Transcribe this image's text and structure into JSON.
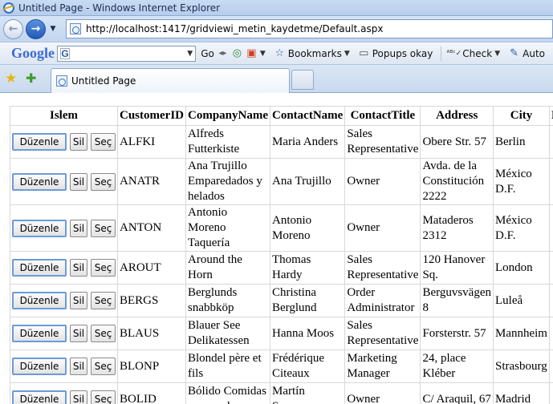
{
  "window": {
    "title": "Untitled Page - Windows Internet Explorer"
  },
  "address_bar": {
    "url": "http://localhost:1417/gridviewi_metin_kaydetme/Default.aspx"
  },
  "toolbar": {
    "google_label": "Google",
    "google_search_prefix": "G",
    "go_label": "Go",
    "bookmarks_label": "Bookmarks",
    "popups_label": "Popups okay",
    "check_label": "Check",
    "auto_label": "Auto"
  },
  "tab": {
    "title": "Untitled Page"
  },
  "grid": {
    "headers": [
      "Islem",
      "CustomerID",
      "CompanyName",
      "ContactName",
      "ContactTitle",
      "Address",
      "City",
      "R"
    ],
    "buttons": {
      "edit": "Düzenle",
      "delete": "Sil",
      "select": "Seç"
    },
    "rows": [
      {
        "id": "ALFKI",
        "company": "Alfreds Futterkiste",
        "contact": "Maria Anders",
        "title": "Sales Representative",
        "address": "Obere Str. 57",
        "city": "Berlin"
      },
      {
        "id": "ANATR",
        "company": "Ana Trujillo Emparedados y helados",
        "contact": "Ana Trujillo",
        "title": "Owner",
        "address": "Avda. de la Constitución 2222",
        "city": "México D.F."
      },
      {
        "id": "ANTON",
        "company": "Antonio Moreno Taquería",
        "contact": "Antonio Moreno",
        "title": "Owner",
        "address": "Mataderos 2312",
        "city": "México D.F."
      },
      {
        "id": "AROUT",
        "company": "Around the Horn",
        "contact": "Thomas Hardy",
        "title": "Sales Representative",
        "address": "120 Hanover Sq.",
        "city": "London"
      },
      {
        "id": "BERGS",
        "company": "Berglunds snabbköp",
        "contact": "Christina Berglund",
        "title": "Order Administrator",
        "address": "Berguvsvägen 8",
        "city": "Luleå"
      },
      {
        "id": "BLAUS",
        "company": "Blauer See Delikatessen",
        "contact": "Hanna Moos",
        "title": "Sales Representative",
        "address": "Forsterstr. 57",
        "city": "Mannheim"
      },
      {
        "id": "BLONP",
        "company": "Blondel père et fils",
        "contact": "Frédérique Citeaux",
        "title": "Marketing Manager",
        "address": "24, place Kléber",
        "city": "Strasbourg"
      },
      {
        "id": "BOLID",
        "company": "Bólido Comidas preparadas",
        "contact": "Martín Sommer",
        "title": "Owner",
        "address": "C/ Araquil, 67",
        "city": "Madrid"
      }
    ]
  }
}
